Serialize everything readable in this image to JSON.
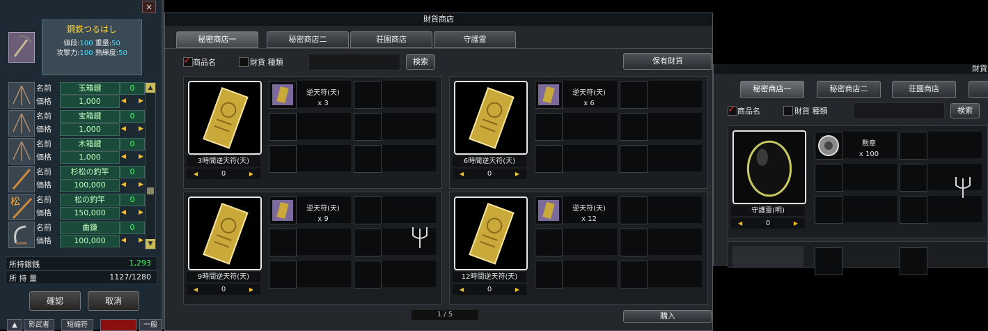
{
  "left_panel": {
    "close_label": "×",
    "selected_item": {
      "name": "鋼鉄つるはし",
      "price_label": "値段:",
      "price": "100",
      "weight_label": "重量:",
      "weight": "50",
      "attack_label": "攻撃力:",
      "attack": "100",
      "skill_label": "熟練度:",
      "skill": "50"
    },
    "name_label": "名前",
    "price_label": "価格",
    "items": [
      {
        "name": "玉箱鍵",
        "price": "1,000",
        "qty": "0"
      },
      {
        "name": "宝箱鍵",
        "price": "1,000",
        "qty": "0"
      },
      {
        "name": "木箱鍵",
        "price": "1,000",
        "qty": "0"
      },
      {
        "name": "杉松の釣竿",
        "price": "100,000",
        "qty": "0"
      },
      {
        "name": "松の釣竿",
        "price": "150,000",
        "qty": "0"
      },
      {
        "name": "曲鎌",
        "price": "100,000",
        "qty": "0"
      }
    ],
    "icon_char_pine": "松",
    "money_label": "所持銀銭",
    "money_value": "1,293",
    "holding_label": "所 持 量",
    "holding_value": "1127/1280",
    "confirm_label": "確認",
    "cancel_label": "取消",
    "bottom_bar": [
      "影武者",
      "短縮符",
      "一般"
    ]
  },
  "main_shop": {
    "title": "財貨商店",
    "tabs": [
      "秘密商店一",
      "秘密商店二",
      "荘園商店",
      "守護霊"
    ],
    "active_tab": 0,
    "filter_name_label": "商品名",
    "filter_type_label": "財貨 種類",
    "search_label": "検索",
    "owned_currency_label": "保有財貨",
    "cards": [
      {
        "title": "3時間逆天符(天)",
        "qty": "0",
        "cost_item": "逆天符(天)",
        "cost_count": "x 3"
      },
      {
        "title": "6時間逆天符(天)",
        "qty": "0",
        "cost_item": "逆天符(天)",
        "cost_count": "x 6"
      },
      {
        "title": "9時間逆天符(天)",
        "qty": "0",
        "cost_item": "逆天符(天)",
        "cost_count": "x 9"
      },
      {
        "title": "12時間逆天符(天)",
        "qty": "0",
        "cost_item": "逆天符(天)",
        "cost_count": "x 12"
      }
    ],
    "page_label": "1 / 5",
    "buy_label": "購入"
  },
  "right_shop": {
    "title": "財貨",
    "tabs": [
      "秘密商店一",
      "秘密商店二",
      "荘園商店"
    ],
    "filter_name_label": "商品名",
    "filter_type_label": "財貨 種類",
    "search_label": "検索",
    "card": {
      "title": "守護霊(明)",
      "qty": "0",
      "cost_item": "勲章",
      "cost_count": "x 100"
    }
  },
  "colors": {
    "accent_gold": "#ffd63a",
    "value_green": "#3fff5a",
    "stat_cyan": "#3fe0ff",
    "check_red": "#e03030"
  },
  "icons": {
    "arrow_left": "◀",
    "arrow_right": "▶",
    "scroll_up": "▲",
    "scroll_down": "▼",
    "check": "✓"
  }
}
